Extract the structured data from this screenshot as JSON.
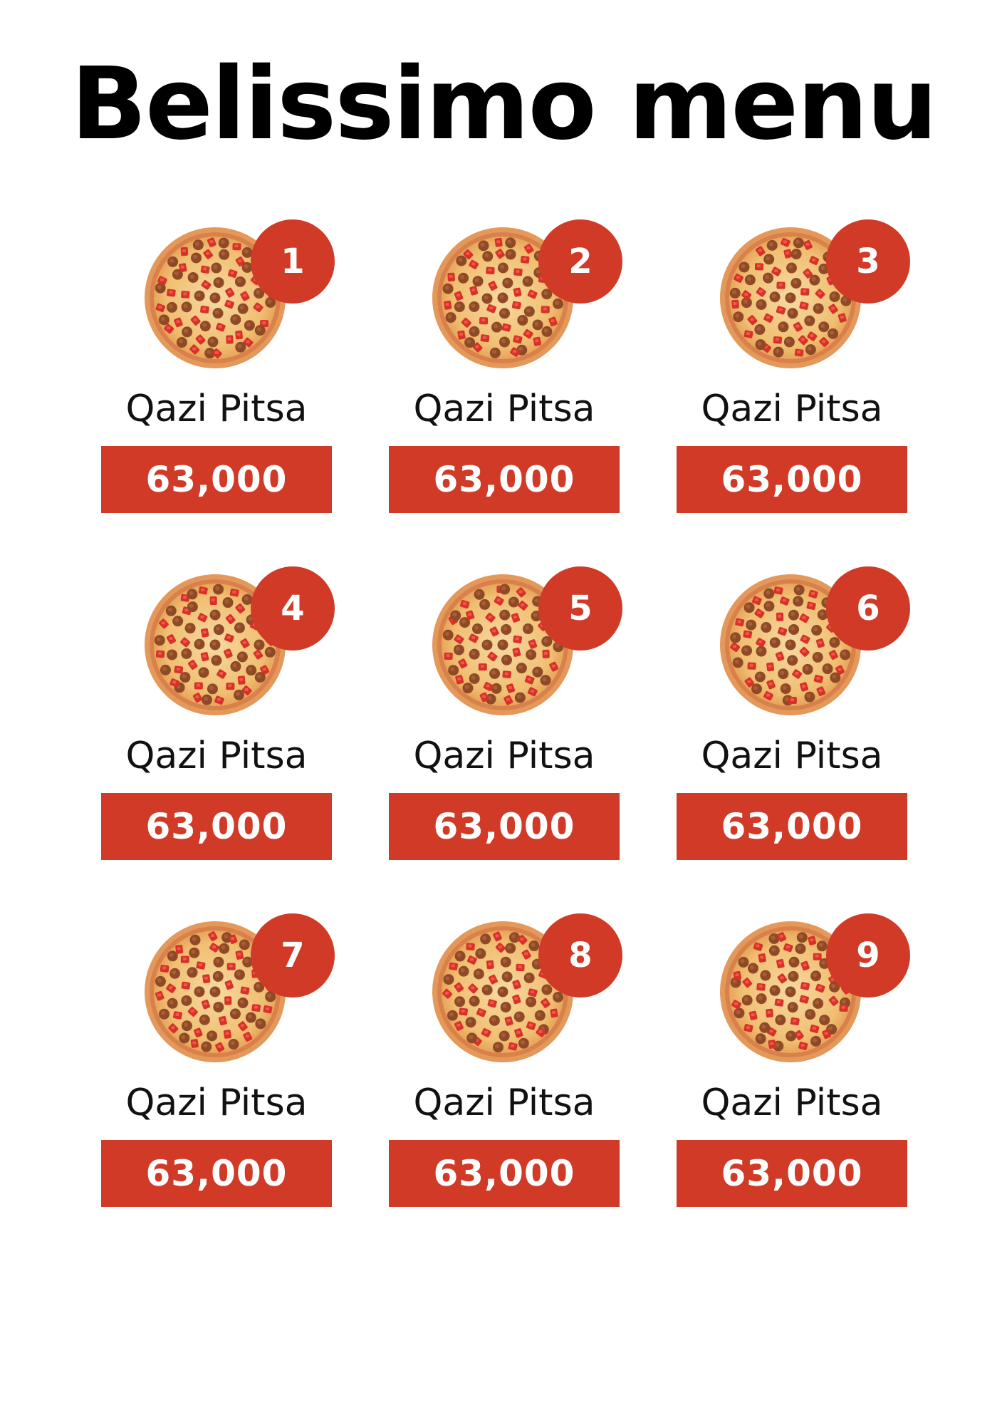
{
  "title": "Belissimo menu",
  "colors": {
    "accent": "#d13a27",
    "text": "#111111",
    "background": "#ffffff"
  },
  "items": [
    {
      "number": "1",
      "name": "Qazi Pitsa",
      "price": "63,000",
      "icon": "pizza-image"
    },
    {
      "number": "2",
      "name": "Qazi Pitsa",
      "price": "63,000",
      "icon": "pizza-image"
    },
    {
      "number": "3",
      "name": "Qazi Pitsa",
      "price": "63,000",
      "icon": "pizza-image"
    },
    {
      "number": "4",
      "name": "Qazi Pitsa",
      "price": "63,000",
      "icon": "pizza-image"
    },
    {
      "number": "5",
      "name": "Qazi Pitsa",
      "price": "63,000",
      "icon": "pizza-image"
    },
    {
      "number": "6",
      "name": "Qazi Pitsa",
      "price": "63,000",
      "icon": "pizza-image"
    },
    {
      "number": "7",
      "name": "Qazi Pitsa",
      "price": "63,000",
      "icon": "pizza-image"
    },
    {
      "number": "8",
      "name": "Qazi Pitsa",
      "price": "63,000",
      "icon": "pizza-image"
    },
    {
      "number": "9",
      "name": "Qazi Pitsa",
      "price": "63,000",
      "icon": "pizza-image"
    }
  ]
}
